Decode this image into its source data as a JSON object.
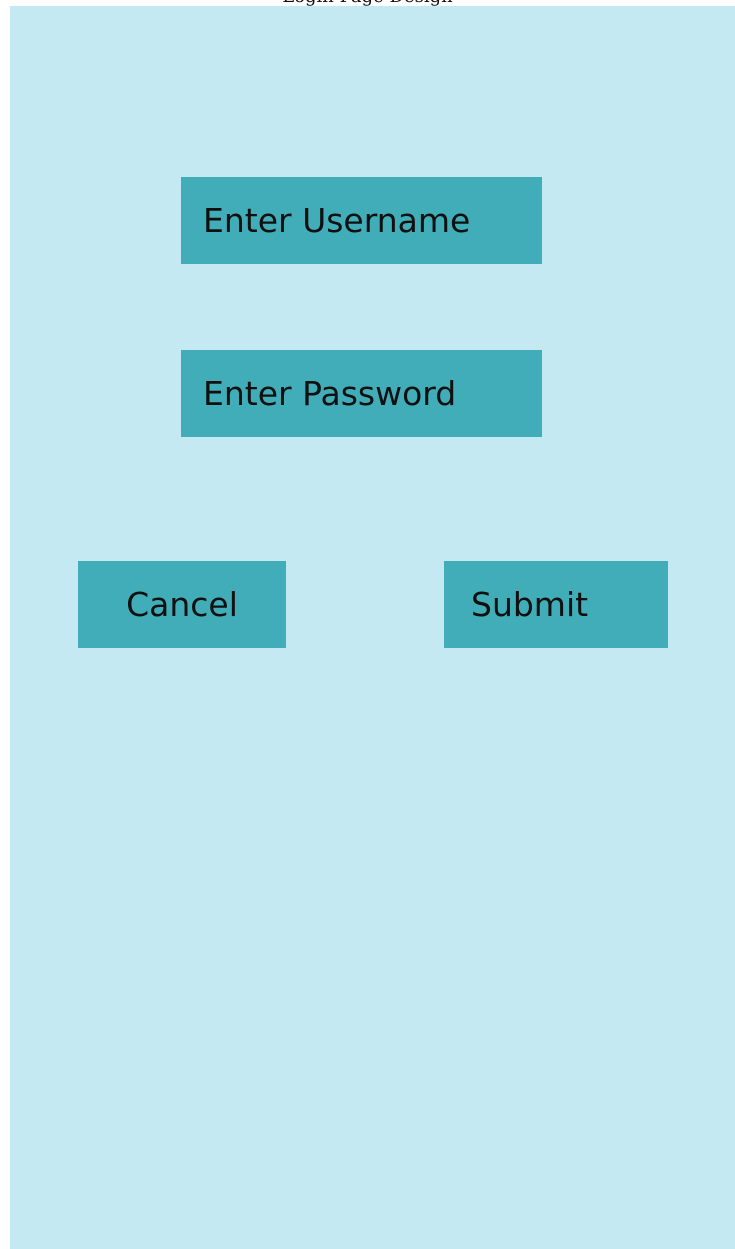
{
  "window": {
    "title": "Login Page Design"
  },
  "form": {
    "username_placeholder": "Enter Username",
    "password_placeholder": "Enter Password"
  },
  "actions": {
    "cancel_label": "Cancel",
    "submit_label": "Submit"
  },
  "colors": {
    "background": "#c4e9f3",
    "accent": "#40adb8",
    "text": "#101010"
  }
}
